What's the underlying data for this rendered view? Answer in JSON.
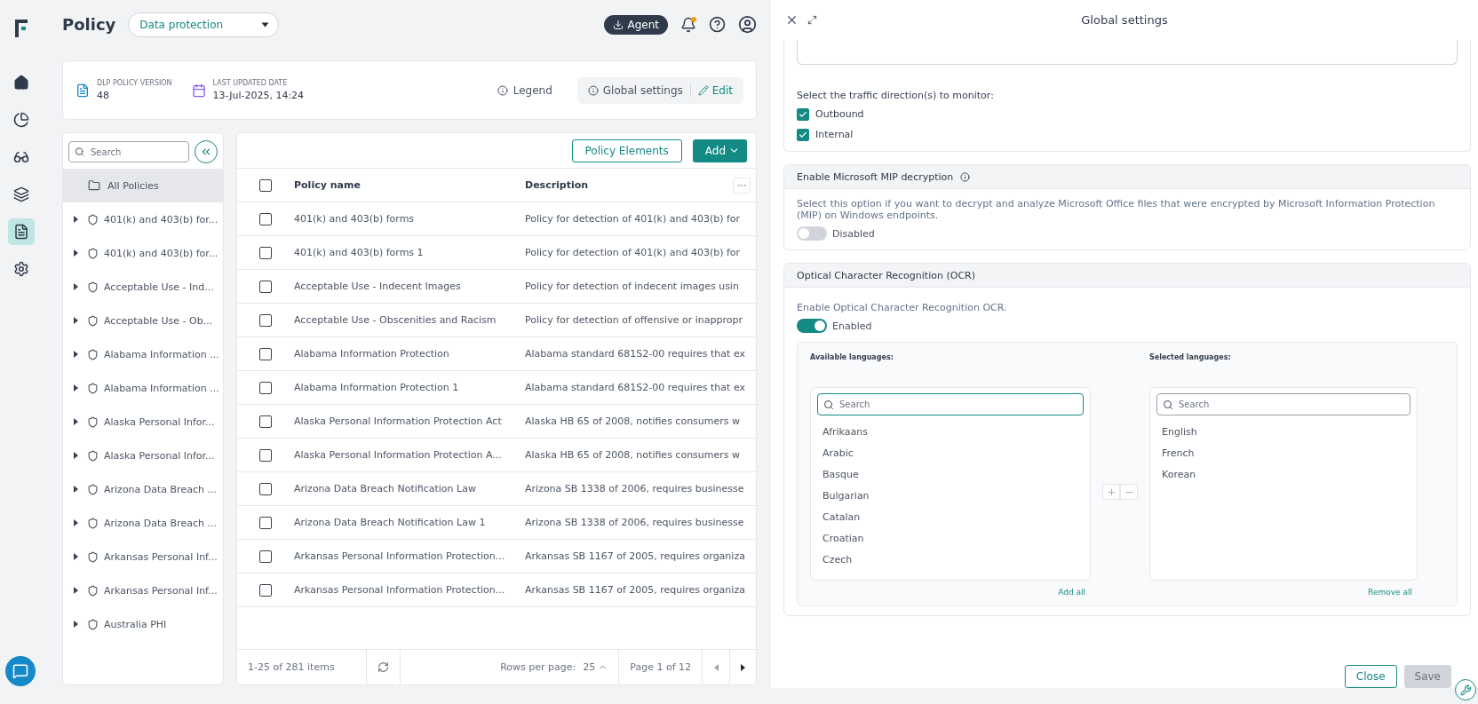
{
  "app": {
    "title": "Policy",
    "policy_type": "Data protection",
    "agent_button": "Agent"
  },
  "nav": [
    {
      "kind": "home",
      "selected": false
    },
    {
      "kind": "chart",
      "selected": false
    },
    {
      "kind": "glasses",
      "selected": false
    },
    {
      "kind": "layers",
      "selected": false
    },
    {
      "kind": "document",
      "selected": true
    },
    {
      "kind": "settings",
      "selected": false
    }
  ],
  "info": {
    "version_label": "DLP POLICY VERSION",
    "version": "48",
    "date_label": "LAST UPDATED DATE",
    "date": "13-Jul-2025, 14:24",
    "legend": "Legend",
    "global_settings": "Global settings",
    "edit": "Edit"
  },
  "tree": {
    "search_placeholder": "Search",
    "root": {
      "label": "All Policies",
      "selected": true
    },
    "items": [
      {
        "label": "401(k) and 403(b) for...",
        "expanded": false
      },
      {
        "label": "401(k) and 403(b) for...",
        "expanded": false
      },
      {
        "label": "Acceptable Use - Ind...",
        "expanded": false
      },
      {
        "label": "Acceptable Use - Ob...",
        "expanded": false
      },
      {
        "label": "Alabama Information ...",
        "expanded": false
      },
      {
        "label": "Alabama Information ...",
        "expanded": false
      },
      {
        "label": "Alaska Personal Infor...",
        "expanded": false
      },
      {
        "label": "Alaska Personal Infor...",
        "expanded": false
      },
      {
        "label": "Arizona Data Breach ...",
        "expanded": false
      },
      {
        "label": "Arizona Data Breach ...",
        "expanded": false
      },
      {
        "label": "Arkansas Personal Inf...",
        "expanded": false
      },
      {
        "label": "Arkansas Personal Inf...",
        "expanded": false
      },
      {
        "label": "Australia PHI",
        "expanded": false
      }
    ]
  },
  "table": {
    "toolbar": {
      "elements": "Policy Elements",
      "add": "Add"
    },
    "header_checked": false,
    "columns": [
      "Policy name",
      "Description"
    ],
    "rows": [
      {
        "name": "401(k) and 403(b) forms",
        "description": "Policy for detection of 401(k) and 403(b) for",
        "checked": false
      },
      {
        "name": "401(k) and 403(b) forms 1",
        "description": "Policy for detection of 401(k) and 403(b) for",
        "checked": false
      },
      {
        "name": "Acceptable Use - Indecent Images",
        "description": "Policy for detection of indecent images usin",
        "checked": false
      },
      {
        "name": "Acceptable Use - Obscenities and Racism",
        "description": "Policy for detection of offensive or inappropr",
        "checked": false
      },
      {
        "name": "Alabama Information Protection",
        "description": "Alabama standard 681S2-00 requires that ex",
        "checked": false
      },
      {
        "name": "Alabama Information Protection 1",
        "description": "Alabama standard 681S2-00 requires that ex",
        "checked": false
      },
      {
        "name": "Alaska Personal Information Protection Act",
        "description": "Alaska HB 65 of 2008, notifies consumers w",
        "checked": false
      },
      {
        "name": "Alaska Personal Information Protection A...",
        "description": "Alaska HB 65 of 2008, notifies consumers w",
        "checked": false
      },
      {
        "name": "Arizona Data Breach Notification Law",
        "description": "Arizona SB 1338 of 2006, requires businesse",
        "checked": false
      },
      {
        "name": "Arizona Data Breach Notification Law 1",
        "description": "Arizona SB 1338 of 2006, requires businesse",
        "checked": false
      },
      {
        "name": "Arkansas Personal Information Protection...",
        "description": "Arkansas SB 1167 of 2005, requires organiza",
        "checked": false
      },
      {
        "name": "Arkansas Personal Information Protection...",
        "description": "Arkansas SB 1167 of 2005, requires organiza",
        "checked": false
      }
    ],
    "footer": {
      "range": "1-25 of 281 items",
      "rows_per_page_label": "Rows per page:",
      "rows_per_page": "25",
      "page": "Page 1 of 12"
    }
  },
  "panel": {
    "title": "Global settings",
    "traffic": {
      "label": "Select the traffic direction(s) to monitor:",
      "options": [
        {
          "label": "Outbound",
          "checked": true
        },
        {
          "label": "Internal",
          "checked": true
        }
      ]
    },
    "mip": {
      "title": "Enable Microsoft MIP decryption",
      "description": "Select this option if you want to decrypt and analyze Microsoft Office files that were encrypted by Microsoft Information Protection (MIP) on Windows endpoints.",
      "toggle": {
        "on": false,
        "label": "Disabled"
      }
    },
    "ocr": {
      "title": "Optical Character Recognition (OCR)",
      "description": "Enable Optical Character Recognition OCR.",
      "toggle": {
        "on": true,
        "label": "Enabled"
      },
      "available": {
        "label": "Available languages:",
        "placeholder": "Search",
        "focused": true,
        "items": [
          "Afrikaans",
          "Arabic",
          "Basque",
          "Bulgarian",
          "Catalan",
          "Croatian",
          "Czech"
        ],
        "action": "Add all"
      },
      "selected": {
        "label": "Selected languages:",
        "placeholder": "Search",
        "focused": false,
        "items": [
          "English",
          "French",
          "Korean"
        ],
        "action": "Remove all"
      }
    },
    "buttons": {
      "close": "Close",
      "save": "Save",
      "save_disabled": true
    }
  }
}
